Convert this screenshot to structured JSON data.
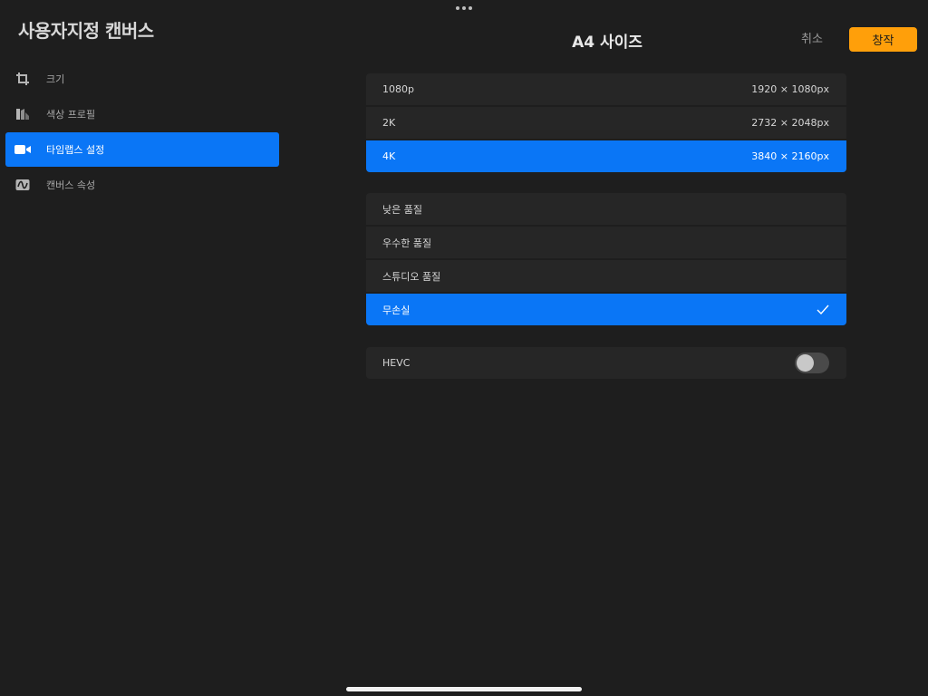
{
  "sidebar": {
    "title": "사용자지정 캔버스",
    "items": [
      {
        "label": "크기",
        "icon": "crop-icon",
        "active": false
      },
      {
        "label": "색상 프로필",
        "icon": "color-profile-icon",
        "active": false
      },
      {
        "label": "타임랩스 설정",
        "icon": "video-camera-icon",
        "active": true
      },
      {
        "label": "캔버스 속성",
        "icon": "canvas-properties-icon",
        "active": false
      }
    ]
  },
  "header": {
    "title": "A4 사이즈",
    "cancel_label": "취소",
    "create_label": "창작"
  },
  "resolution": {
    "options": [
      {
        "label": "1080p",
        "value": "1920 × 1080px",
        "selected": false
      },
      {
        "label": "2K",
        "value": "2732 × 2048px",
        "selected": false
      },
      {
        "label": "4K",
        "value": "3840 × 2160px",
        "selected": true
      }
    ]
  },
  "quality": {
    "options": [
      {
        "label": "낮은 품질",
        "selected": false
      },
      {
        "label": "우수한 품질",
        "selected": false
      },
      {
        "label": "스튜디오 품질",
        "selected": false
      },
      {
        "label": "무손실",
        "selected": true
      }
    ]
  },
  "hevc": {
    "label": "HEVC",
    "enabled": false
  },
  "colors": {
    "accent": "#0a76f6",
    "create_button": "#ff9f0a",
    "background": "#1e1e1e",
    "row": "#262626"
  }
}
